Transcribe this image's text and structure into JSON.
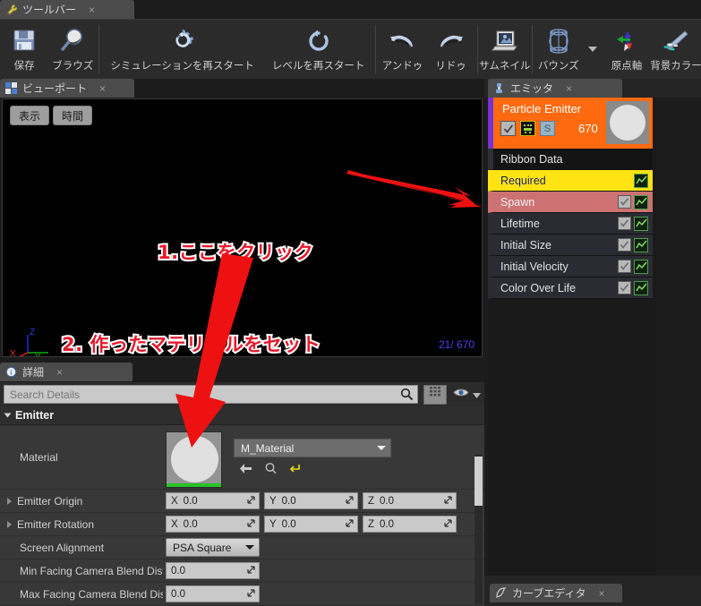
{
  "toolbar": {
    "tab_label": "ツールバー",
    "tab_icon": "wrench-icon",
    "close_label": "×",
    "buttons": [
      {
        "label": "保存",
        "icon": "save-icon"
      },
      {
        "label": "ブラウズ",
        "icon": "browse-magnifier-icon"
      },
      {
        "label": "シミュレーションを再スタート",
        "icon": "restart-sim-gear-icon"
      },
      {
        "label": "レベルを再スタート",
        "icon": "restart-level-icon"
      },
      {
        "label": "アンドゥ",
        "icon": "undo-icon"
      },
      {
        "label": "リドゥ",
        "icon": "redo-icon"
      },
      {
        "label": "サムネイル",
        "icon": "thumbnail-icon"
      },
      {
        "label": "バウンズ",
        "icon": "bounds-icon"
      },
      {
        "label": "原点軸",
        "icon": "origin-axis-icon"
      },
      {
        "label": "背景カラー",
        "icon": "background-color-icon"
      }
    ]
  },
  "viewport": {
    "tab_label": "ビューポート",
    "tab_icon": "viewport-grid-icon",
    "close_label": "×",
    "buttons": [
      {
        "label": "表示"
      },
      {
        "label": "時間"
      }
    ],
    "frame_counter": "21/ 670",
    "axis_labels": {
      "z": "Z",
      "y": "Y",
      "x": "X"
    },
    "annotations": [
      {
        "text": "1.ここをクリック"
      },
      {
        "text": "2. 作ったマテリアルをセット"
      }
    ]
  },
  "emitter": {
    "tab_label": "エミッタ",
    "tab_icon": "emitter-icon",
    "close_label": "×",
    "header": {
      "title": "Particle Emitter",
      "count": "670",
      "enabled_checkbox": "checked",
      "solo_label": "S",
      "accent_color": "#ff6a10",
      "sidebar_color": "#7b2fd6"
    },
    "modules": [
      {
        "label": "Ribbon Data",
        "style": "header",
        "checkbox": false,
        "curve": false
      },
      {
        "label": "Required",
        "style": "yellow",
        "checkbox": false,
        "curve": true
      },
      {
        "label": "Spawn",
        "style": "salmon",
        "checkbox": true,
        "curve": true
      },
      {
        "label": "Lifetime",
        "style": "dark",
        "checkbox": true,
        "curve": true
      },
      {
        "label": "Initial Size",
        "style": "dark",
        "checkbox": true,
        "curve": true
      },
      {
        "label": "Initial Velocity",
        "style": "dark",
        "checkbox": true,
        "curve": true
      },
      {
        "label": "Color Over Life",
        "style": "dark",
        "checkbox": true,
        "curve": true
      }
    ]
  },
  "curve_editor": {
    "tab_label": "カーブエディタ",
    "tab_icon": "curve-icon",
    "close_label": "×"
  },
  "details": {
    "tab_label": "詳細",
    "tab_icon": "details-info-icon",
    "close_label": "×",
    "search": {
      "value": "",
      "placeholder": "Search Details"
    },
    "grid_button_icon": "grid-view-icon",
    "eye_button_icon": "eye-icon",
    "category": "Emitter",
    "properties": {
      "material": {
        "label": "Material",
        "value": "M_Material",
        "back_icon": "back-arrow-icon",
        "browse_icon": "browse-icon",
        "reset_icon": "reset-icon"
      },
      "emitter_origin": {
        "label": "Emitter Origin",
        "x": "0.0",
        "y": "0.0",
        "z": "0.0",
        "axis_x": "X",
        "axis_y": "Y",
        "axis_z": "Z"
      },
      "emitter_rotation": {
        "label": "Emitter Rotation",
        "x": "0.0",
        "y": "0.0",
        "z": "0.0",
        "axis_x": "X",
        "axis_y": "Y",
        "axis_z": "Z"
      },
      "screen_alignment": {
        "label": "Screen Alignment",
        "value": "PSA Square"
      },
      "min_facing": {
        "label": "Min Facing Camera Blend Distan",
        "value": "0.0"
      },
      "max_facing": {
        "label": "Max Facing Camera Blend Distar",
        "value": "0.0"
      }
    }
  },
  "colors": {
    "annotation_red": "#e8192c",
    "emitter_orange": "#ff6a10",
    "required_yellow": "#ffe313",
    "spawn_salmon": "#cd7272",
    "frame_blue": "#4b3ff0"
  }
}
